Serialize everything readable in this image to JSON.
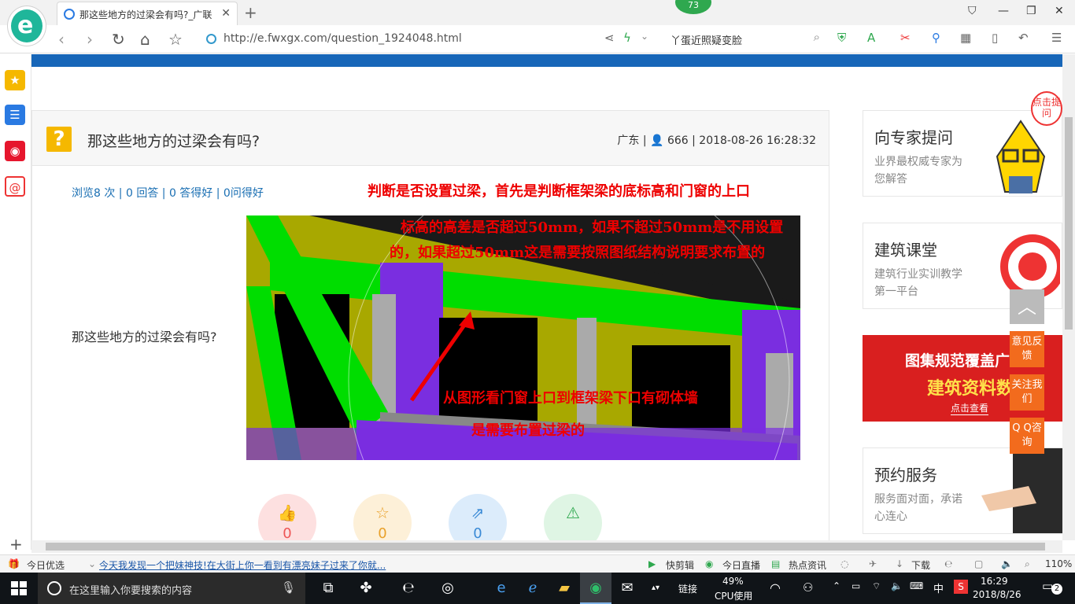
{
  "browser": {
    "tab_title": "那这些地方的过梁会有吗?_广联",
    "tab_close": "✕",
    "new_tab": "+",
    "badge": "73",
    "url": "http://e.fwxgx.com/question_1924048.html",
    "search_text": "丫蛋近照疑变脸",
    "window": {
      "shirt": "⛉",
      "minimize": "—",
      "restore": "❐",
      "close": "✕"
    }
  },
  "question": {
    "title": "那这些地方的过梁会有吗?",
    "region": "广东",
    "user": "666",
    "datetime": "2018-08-26 16:28:32",
    "stats": "浏览8 次 | 0 回答 | 0 答得好 | 0问得好",
    "body_text": "那这些地方的过梁会有吗?"
  },
  "annotations": {
    "line1": "判断是否设置过梁，首先是判断框架梁的底标高和门窗的上口",
    "line2": "标高的高差是否超过50mm，如果不超过50mm是不用设置",
    "line3": "的，如果超过50mm这是需要按照图纸结构说明要求布置的",
    "line4": "从图形看门窗上口到框架梁下口有砌体墙",
    "line5": "是需要布置过梁的"
  },
  "actions": [
    {
      "name": "like",
      "icon": "👍",
      "count": "0"
    },
    {
      "name": "favorite",
      "icon": "☆",
      "count": "0"
    },
    {
      "name": "share",
      "icon": "⇗",
      "count": "0"
    },
    {
      "name": "report",
      "icon": "⚠",
      "count": ""
    }
  ],
  "sidebar_cards": {
    "expert": {
      "title": "向专家提问",
      "subtitle": "业界最权威专家为您解答",
      "bubble": "点击提问"
    },
    "classroom": {
      "title": "建筑课堂",
      "subtitle": "建筑行业实训教学第一平台"
    },
    "banner": {
      "line1": "图集规范覆盖广",
      "line2": "建筑资料数",
      "cta": "点击查看"
    },
    "service": {
      "title": "预约服务",
      "subtitle": "服务面对面，承诺心连心"
    }
  },
  "float_buttons": {
    "feedback": "意见反馈",
    "follow": "关注我们",
    "qq": "Q Q咨询",
    "backtop": "︿"
  },
  "statusbar": {
    "today": "今日优选",
    "news": "今天我发现一个把妹神技!在大街上你一看到有漂亮妹子过来了你就...",
    "clip": "快剪辑",
    "live": "今日直播",
    "hot": "热点资讯",
    "download": "下载",
    "zoom": "110%"
  },
  "taskbar": {
    "search_placeholder": "在这里输入你要搜索的内容",
    "link": "链接",
    "cpu_percent": "49%",
    "cpu_label": "CPU使用",
    "ime": "中",
    "time": "16:29",
    "date": "2018/8/26",
    "notifications": "2"
  },
  "colors": {
    "accent_blue": "#1766b8",
    "annotation_red": "#e00000",
    "float_orange": "#f26b1d",
    "link_blue": "#1a6fb3"
  }
}
